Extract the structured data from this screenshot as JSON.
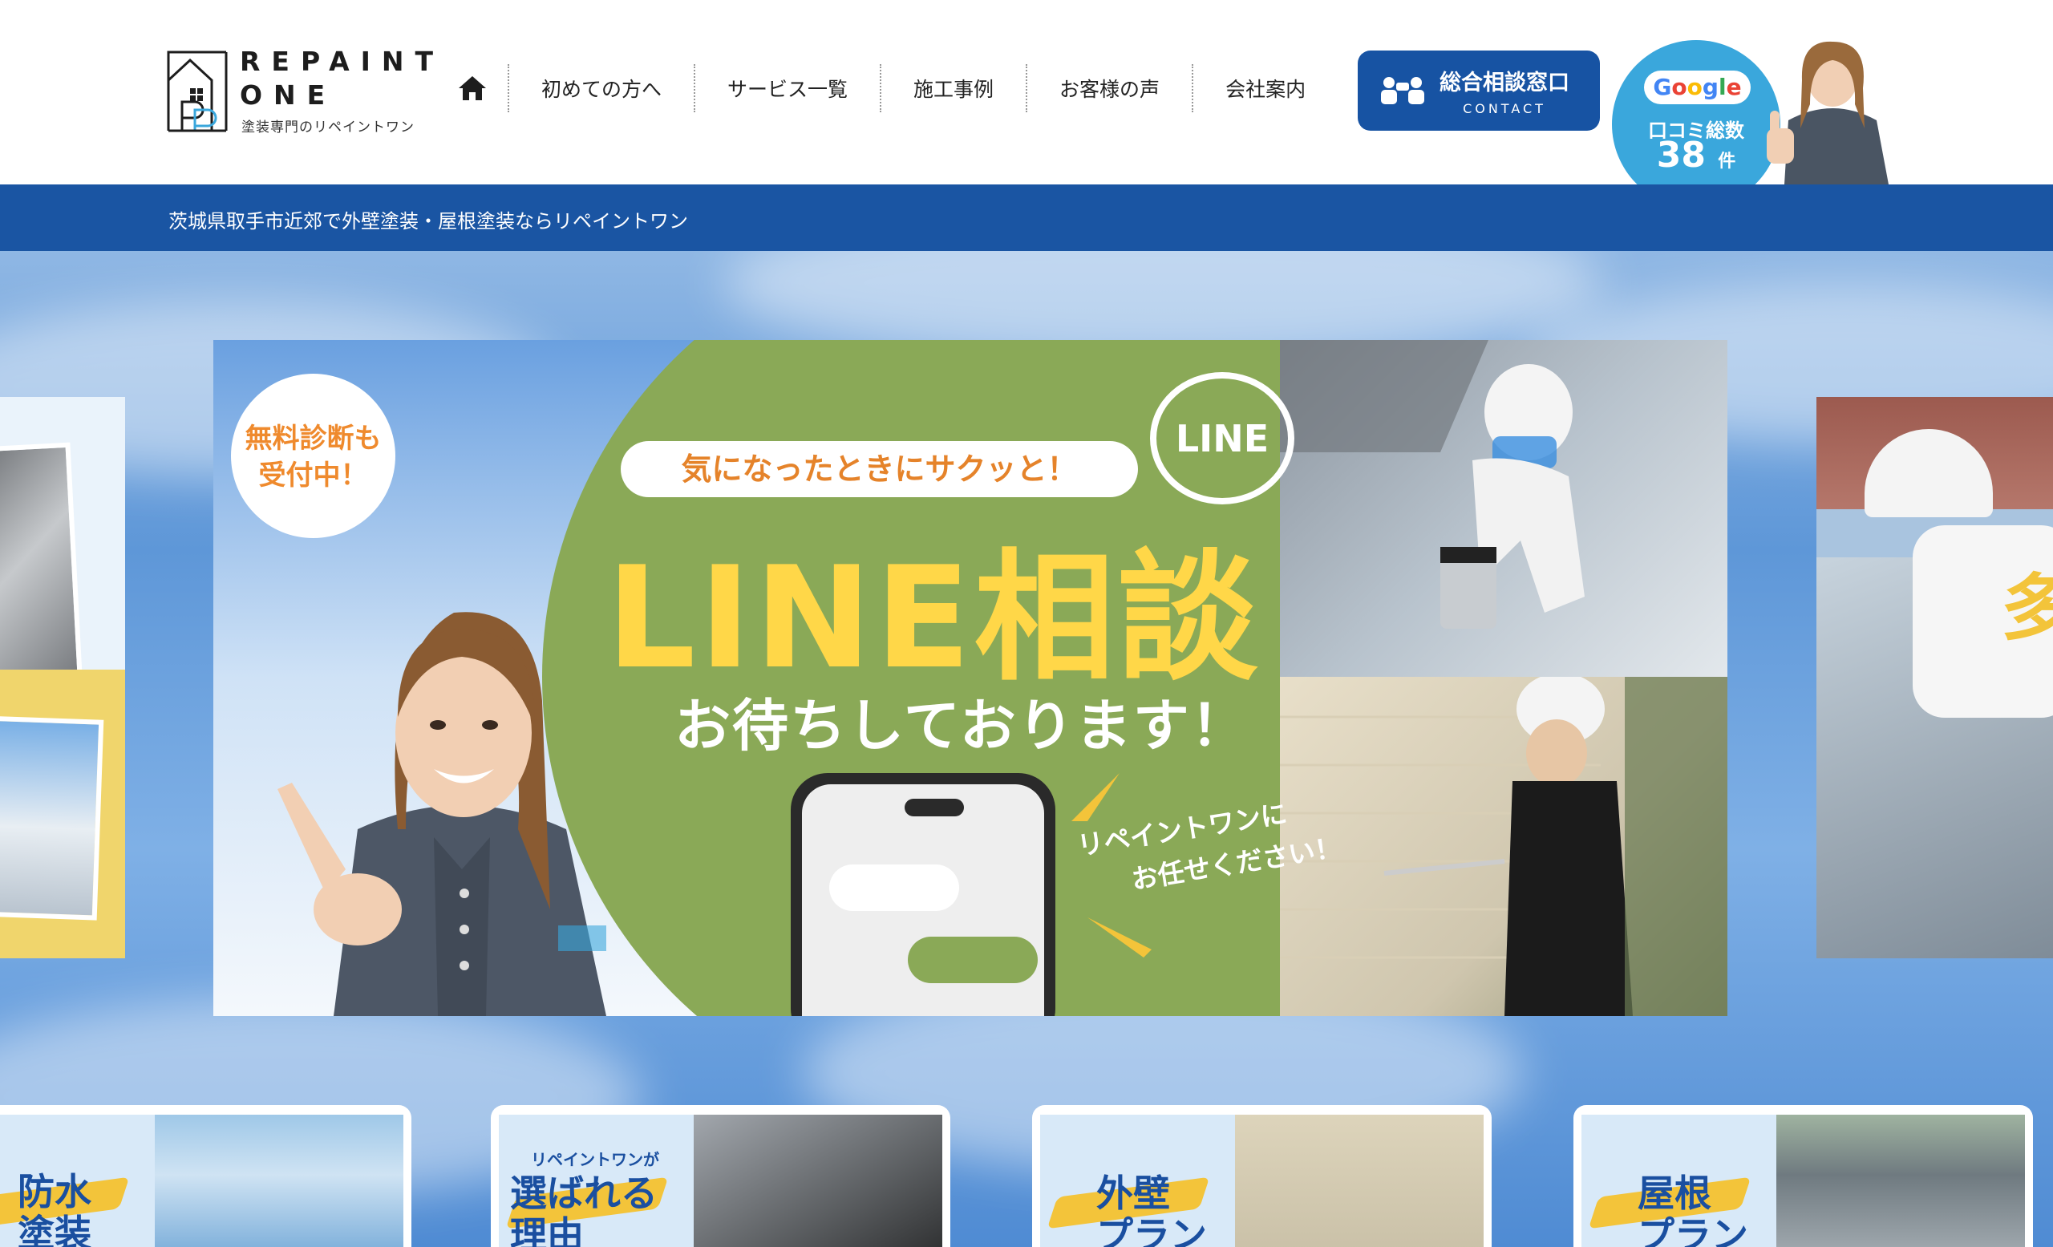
{
  "header": {
    "logo": {
      "line1": "REPAINT",
      "line2": "ONE",
      "sub": "塗装専門のリペイントワン"
    },
    "nav": [
      {
        "label": "初めての方へ"
      },
      {
        "label": "サービス一覧"
      },
      {
        "label": "施工事例"
      },
      {
        "label": "お客様の声"
      },
      {
        "label": "会社案内"
      }
    ],
    "contact": {
      "main": "総合相談窓口",
      "sub": "CONTACT"
    },
    "review": {
      "brand": "Google",
      "label": "口コミ総数",
      "count": "38",
      "unit": "件"
    }
  },
  "bluebar": {
    "text": "茨城県取手市近郊で外壁塗装・屋根塗装ならリペイントワン"
  },
  "banner": {
    "bubble": "無料診断も\n受付中！",
    "pill": "気になったときにサクッと！",
    "line_badge": "LINE",
    "title": "LINE相談",
    "subtitle": "お待ちしております！",
    "tagline_1": "リペイントワンに",
    "tagline_2": "お任せください！"
  },
  "cards": [
    {
      "label": "防水\n塗装",
      "small": ""
    },
    {
      "label": "選ばれる\n理由",
      "small": "リペイントワンが"
    },
    {
      "label": "外壁\nプラン",
      "small": ""
    },
    {
      "label": "屋根\nプラン",
      "small": ""
    }
  ],
  "colors": {
    "brand_blue": "#1a55a3",
    "review_blue": "#3aa7dc",
    "banner_green": "#8aa957",
    "title_yellow": "#ffd748",
    "accent_orange": "#e5832a"
  }
}
